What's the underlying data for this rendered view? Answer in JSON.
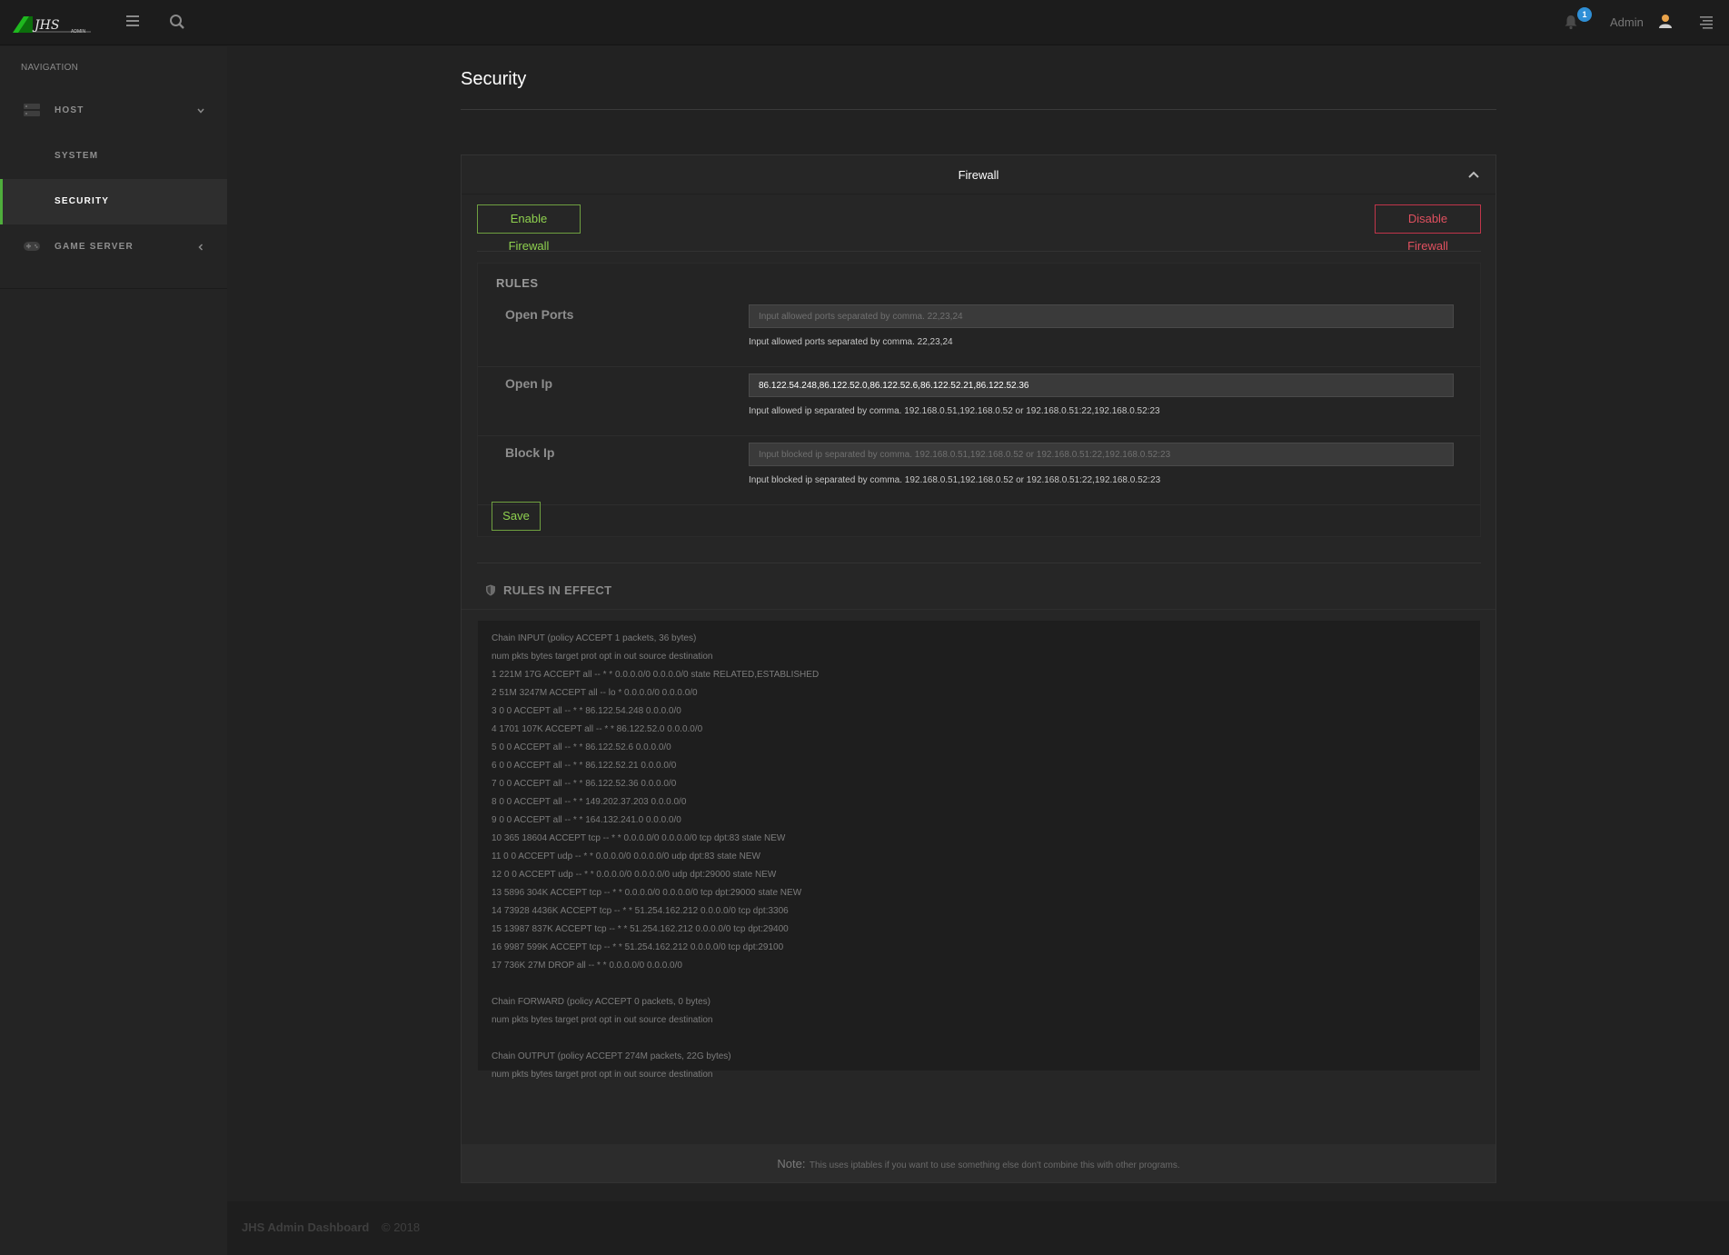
{
  "topbar": {
    "notification_count": "1",
    "admin_name": "Admin"
  },
  "sidebar": {
    "title": "NAVIGATION",
    "items": [
      {
        "label": "HOST"
      },
      {
        "label": "SYSTEM"
      },
      {
        "label": "SECURITY"
      },
      {
        "label": "GAME SERVER"
      }
    ]
  },
  "page": {
    "title": "Security"
  },
  "firewall": {
    "title": "Firewall",
    "enable_label": "Enable Firewall",
    "disable_label": "Disable Firewall",
    "rules_heading": "RULES",
    "open_ports": {
      "label": "Open Ports",
      "value": "",
      "placeholder": "Input allowed ports separated by comma. 22,23,24",
      "help": "Input allowed ports separated by comma. 22,23,24"
    },
    "open_ip": {
      "label": "Open Ip",
      "value": "86.122.54.248,86.122.52.0,86.122.52.6,86.122.52.21,86.122.52.36",
      "placeholder": "",
      "help": "Input allowed ip separated by comma. 192.168.0.51,192.168.0.52 or 192.168.0.51:22,192.168.0.52:23"
    },
    "block_ip": {
      "label": "Block Ip",
      "value": "",
      "placeholder": "Input blocked ip separated by comma. 192.168.0.51,192.168.0.52 or 192.168.0.51:22,192.168.0.52:23",
      "help": "Input blocked ip separated by comma. 192.168.0.51,192.168.0.52 or 192.168.0.51:22,192.168.0.52:23"
    },
    "save_label": "Save",
    "effect_heading": "RULES IN EFFECT",
    "effect_lines": [
      "Chain INPUT (policy ACCEPT 1 packets, 36 bytes)",
      "num pkts bytes target prot opt in out source destination",
      "1 221M 17G ACCEPT all -- * * 0.0.0.0/0 0.0.0.0/0 state RELATED,ESTABLISHED",
      "2 51M 3247M ACCEPT all -- lo * 0.0.0.0/0 0.0.0.0/0",
      "3 0 0 ACCEPT all -- * * 86.122.54.248 0.0.0.0/0",
      "4 1701 107K ACCEPT all -- * * 86.122.52.0 0.0.0.0/0",
      "5 0 0 ACCEPT all -- * * 86.122.52.6 0.0.0.0/0",
      "6 0 0 ACCEPT all -- * * 86.122.52.21 0.0.0.0/0",
      "7 0 0 ACCEPT all -- * * 86.122.52.36 0.0.0.0/0",
      "8 0 0 ACCEPT all -- * * 149.202.37.203 0.0.0.0/0",
      "9 0 0 ACCEPT all -- * * 164.132.241.0 0.0.0.0/0",
      "10 365 18604 ACCEPT tcp -- * * 0.0.0.0/0 0.0.0.0/0 tcp dpt:83 state NEW",
      "11 0 0 ACCEPT udp -- * * 0.0.0.0/0 0.0.0.0/0 udp dpt:83 state NEW",
      "12 0 0 ACCEPT udp -- * * 0.0.0.0/0 0.0.0.0/0 udp dpt:29000 state NEW",
      "13 5896 304K ACCEPT tcp -- * * 0.0.0.0/0 0.0.0.0/0 tcp dpt:29000 state NEW",
      "14 73928 4436K ACCEPT tcp -- * * 51.254.162.212 0.0.0.0/0 tcp dpt:3306",
      "15 13987 837K ACCEPT tcp -- * * 51.254.162.212 0.0.0.0/0 tcp dpt:29400",
      "16 9987 599K ACCEPT tcp -- * * 51.254.162.212 0.0.0.0/0 tcp dpt:29100",
      "17 736K 27M DROP all -- * * 0.0.0.0/0 0.0.0.0/0",
      "",
      "Chain FORWARD (policy ACCEPT 0 packets, 0 bytes)",
      "num pkts bytes target prot opt in out source destination",
      "",
      "Chain OUTPUT (policy ACCEPT 274M packets, 22G bytes)",
      "num pkts bytes target prot opt in out source destination"
    ],
    "note_label": "Note:",
    "note_text": "This uses iptables if you want to use something else don't combine this with other programs."
  },
  "footer": {
    "brand": "JHS Admin Dashboard",
    "year": "© 2018"
  },
  "colors": {
    "accent_green": "#8fd14f",
    "danger_red": "#e0505f",
    "badge_blue": "#2f8fd6"
  }
}
